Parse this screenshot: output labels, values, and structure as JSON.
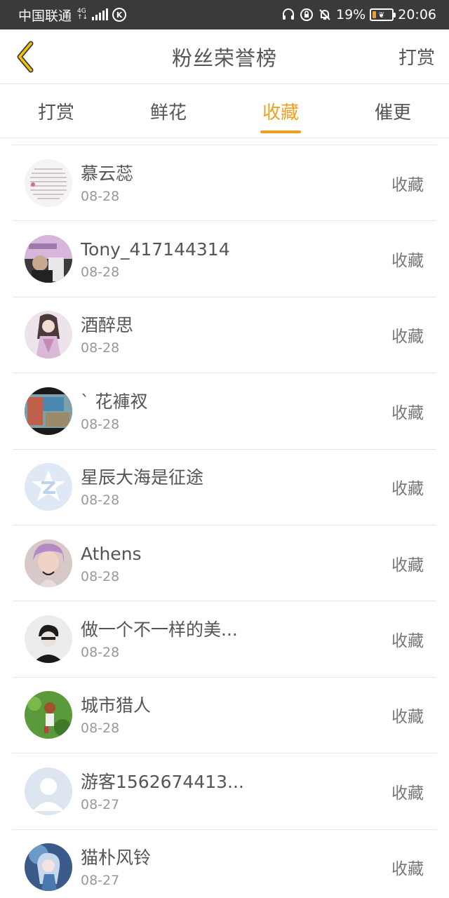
{
  "status_bar": {
    "carrier": "中国联通",
    "net_type_top": "4G",
    "net_type_bottom": "↑↓",
    "k_badge": "K",
    "battery_percent": "19%",
    "battery_level": 0.19,
    "time": "20:06",
    "icons": [
      "headphones-icon",
      "lock-rotation-icon",
      "bell-off-icon",
      "battery-icon"
    ]
  },
  "header": {
    "title": "粉丝荣誉榜",
    "right_action": "打赏",
    "back_icon": "chevron-left-icon",
    "accent_color": "#f0a020"
  },
  "tabs": [
    {
      "label": "打赏",
      "active": false
    },
    {
      "label": "鲜花",
      "active": false
    },
    {
      "label": "收藏",
      "active": true
    },
    {
      "label": "催更",
      "active": false
    }
  ],
  "fans": [
    {
      "name": "慕云蕊",
      "date": "08-28",
      "action": "收藏",
      "avatar": "text-image-avatar"
    },
    {
      "name": "Tony_417144314",
      "date": "08-28",
      "action": "收藏",
      "avatar": "photo-avatar"
    },
    {
      "name": "酒醉思",
      "date": "08-28",
      "action": "收藏",
      "avatar": "anime-girl-avatar"
    },
    {
      "name": "ˋ 花褲衩",
      "date": "08-28",
      "action": "收藏",
      "avatar": "photo-avatar"
    },
    {
      "name": "星辰大海是征途",
      "date": "08-28",
      "action": "收藏",
      "avatar": "qzone-default-avatar"
    },
    {
      "name": "Athens",
      "date": "08-28",
      "action": "收藏",
      "avatar": "photo-avatar"
    },
    {
      "name": "做一个不一样的美...",
      "date": "08-28",
      "action": "收藏",
      "avatar": "photo-avatar"
    },
    {
      "name": "城市猎人",
      "date": "08-28",
      "action": "收藏",
      "avatar": "game-character-avatar"
    },
    {
      "name": "游客1562674413...",
      "date": "08-27",
      "action": "收藏",
      "avatar": "default-person-avatar"
    },
    {
      "name": "猫朴风铃",
      "date": "08-27",
      "action": "收藏",
      "avatar": "anime-avatar"
    }
  ]
}
